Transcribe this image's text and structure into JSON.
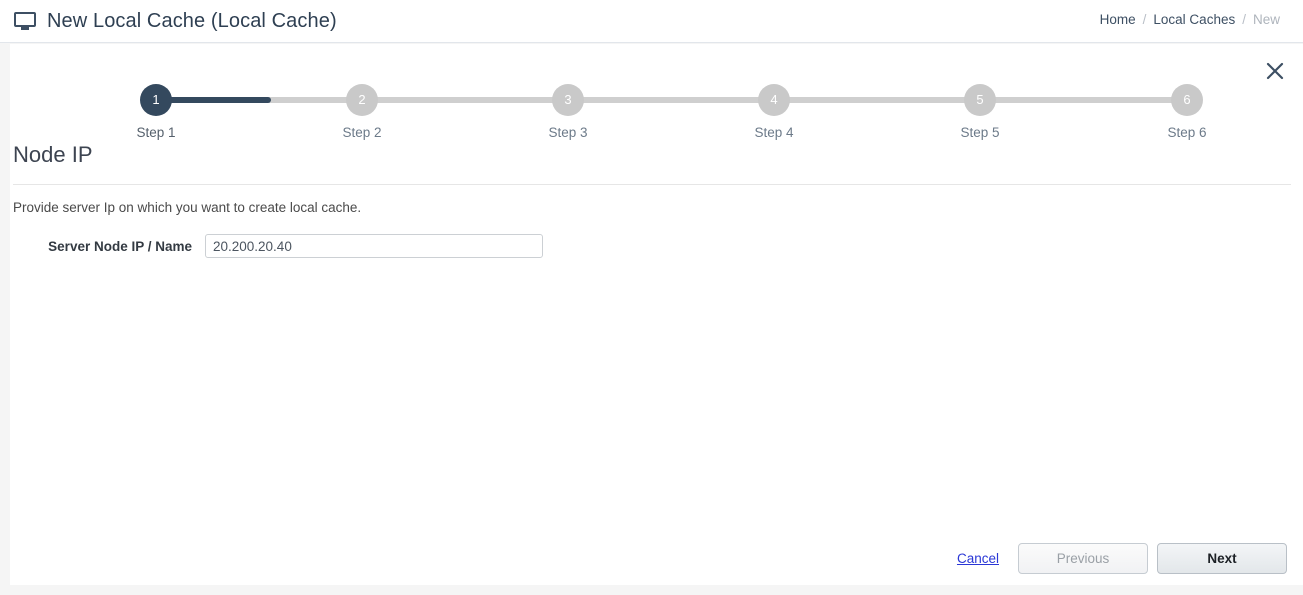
{
  "header": {
    "icon": "monitor-icon",
    "title": "New Local Cache (Local Cache)",
    "breadcrumb": [
      {
        "label": "Home",
        "current": false
      },
      {
        "label": "Local Caches",
        "current": false
      },
      {
        "label": "New",
        "current": true
      }
    ],
    "separator": "/"
  },
  "panel": {
    "close_icon": "close-icon",
    "stepper": {
      "active_index": 1,
      "steps": [
        {
          "number": "1",
          "label": "Step 1"
        },
        {
          "number": "2",
          "label": "Step 2"
        },
        {
          "number": "3",
          "label": "Step 3"
        },
        {
          "number": "4",
          "label": "Step 4"
        },
        {
          "number": "5",
          "label": "Step 5"
        },
        {
          "number": "6",
          "label": "Step 6"
        }
      ]
    },
    "heading": "Node IP",
    "description": "Provide server Ip on which you want to create local cache.",
    "form": {
      "server_node": {
        "label": "Server Node IP / Name",
        "value": "20.200.20.40",
        "placeholder": ""
      }
    },
    "actions": {
      "cancel_label": "Cancel",
      "previous_label": "Previous",
      "next_label": "Next"
    }
  },
  "colors": {
    "accent_dark": "#34495e",
    "step_inactive": "#c9c9c9",
    "link": "#2a37d6",
    "panel_bg": "#ffffff",
    "page_bg": "#f5f5f5"
  }
}
